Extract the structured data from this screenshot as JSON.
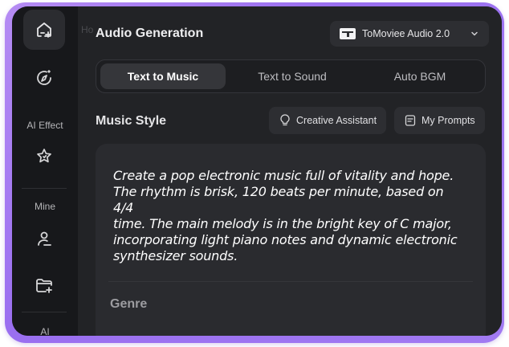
{
  "sidebar": {
    "items": [
      {
        "name": "home",
        "icon": "home-plus-icon"
      },
      {
        "name": "explore",
        "icon": "compass-icon"
      }
    ],
    "ai_effect_label": "AI Effect",
    "ai_effect_icon": "sparkle-star-icon",
    "mine_label": "Mine",
    "mine_items": [
      {
        "icon": "user-music-icon"
      },
      {
        "icon": "folder-add-icon"
      }
    ],
    "bottom_label": "AI"
  },
  "main": {
    "ghost_text": "Ho",
    "title": "Audio Generation",
    "model_select": {
      "value": "ToMoviee Audio 2.0",
      "icon": "tomoviee-logo-icon"
    },
    "tabs": [
      {
        "label": "Text to Music",
        "active": true
      },
      {
        "label": "Text to Sound",
        "active": false
      },
      {
        "label": "Auto BGM",
        "active": false
      }
    ],
    "section_title": "Music Style",
    "creative_assistant_label": "Creative Assistant",
    "my_prompts_label": "My Prompts",
    "prompt_lines": [
      "Create a pop electronic music full of vitality and hope.",
      "The rhythm is brisk, 120 beats per minute, based on 4/4",
      "time. The main melody is in the bright key of C major,",
      "incorporating light piano notes and dynamic electronic",
      "synthesizer sounds."
    ],
    "genre_label": "Genre"
  },
  "colors": {
    "frame_gradient_start": "#b58cf3",
    "frame_gradient_end": "#9a6ff0",
    "background": "#222326",
    "sidebar": "#17181b",
    "card": "#2a2b2f",
    "text_primary": "#ffffff"
  }
}
